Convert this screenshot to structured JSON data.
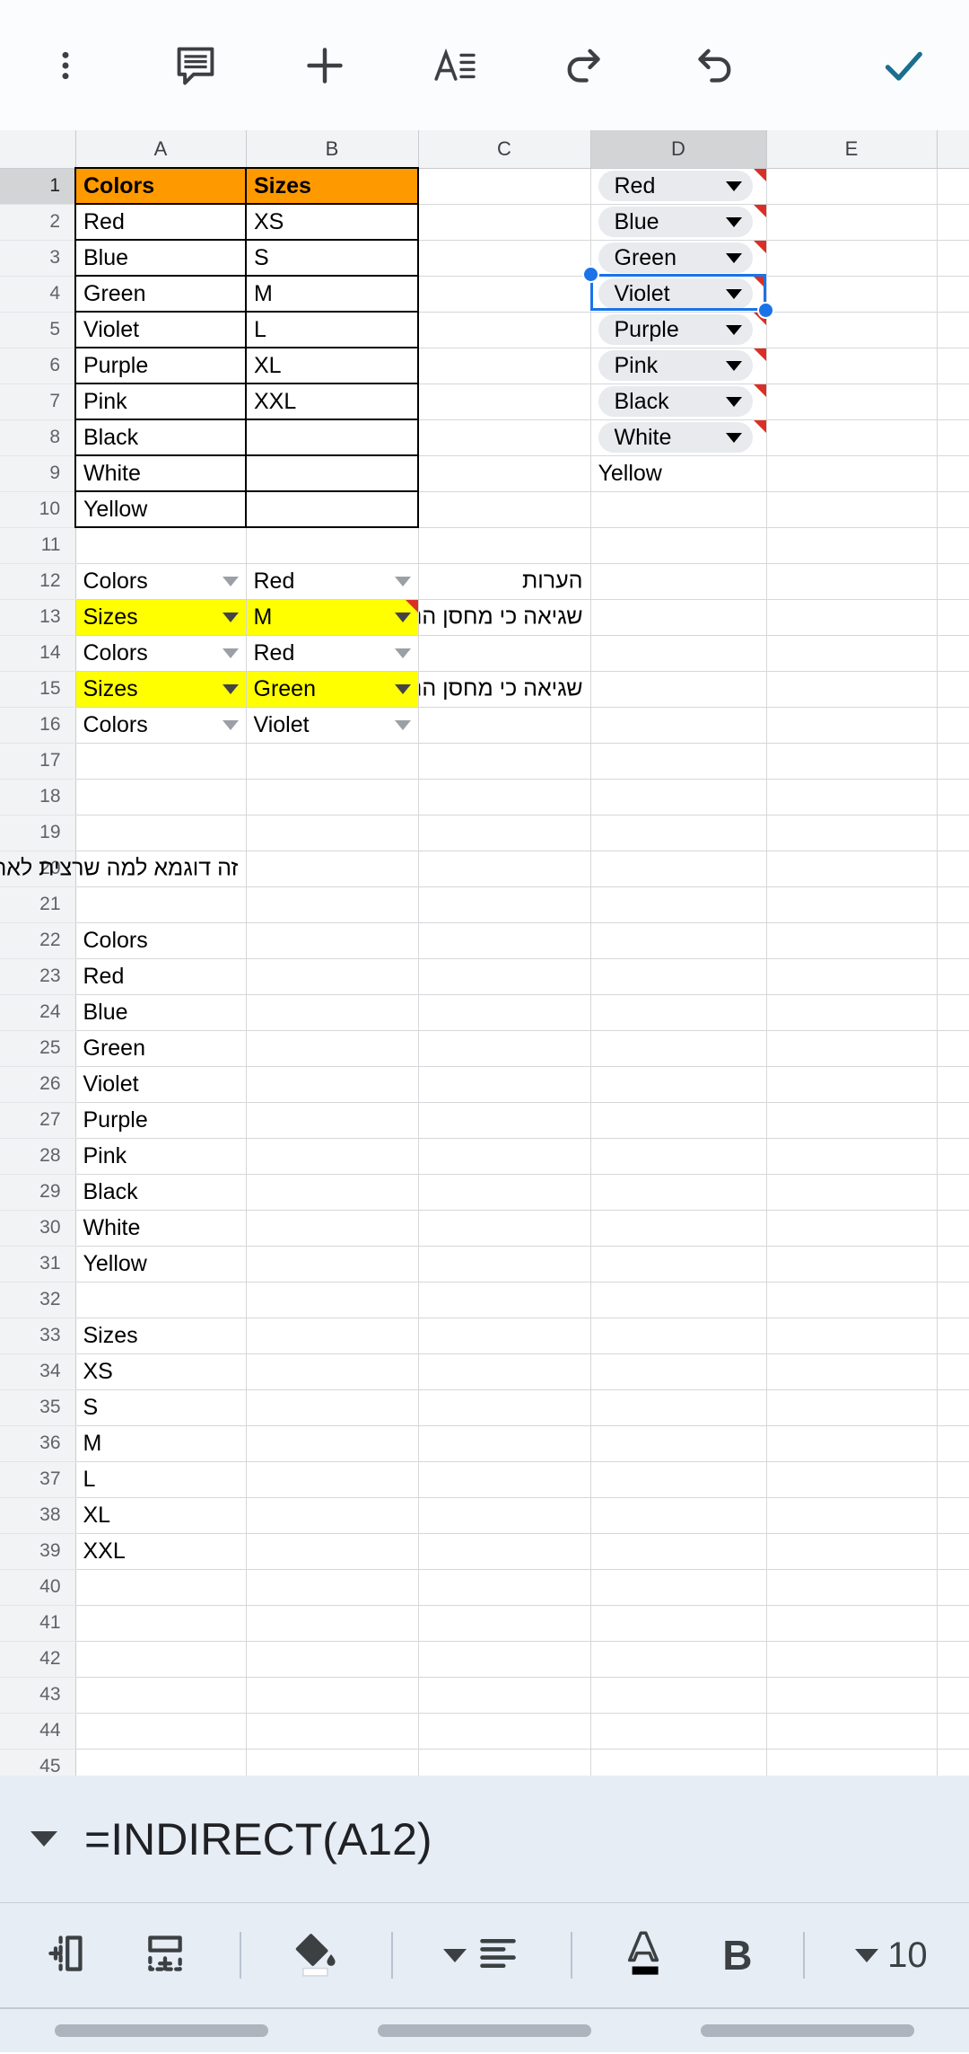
{
  "top_toolbar": {
    "buttons": [
      {
        "name": "more-options-button",
        "icon": "kebab-menu-icon"
      },
      {
        "name": "comment-button",
        "icon": "comment-icon"
      },
      {
        "name": "insert-button",
        "icon": "plus-icon"
      },
      {
        "name": "format-text-button",
        "icon": "format-text-icon"
      },
      {
        "name": "redo-button",
        "icon": "redo-icon"
      },
      {
        "name": "undo-button",
        "icon": "undo-icon"
      },
      {
        "name": "confirm-button",
        "icon": "checkmark-icon"
      }
    ],
    "accent_color": "#1a6f8f"
  },
  "grid": {
    "columns": [
      "A",
      "B",
      "C",
      "D",
      "E"
    ],
    "selected_column": "D",
    "selected_row": 1,
    "selected_cell": "D1",
    "first_row": 1,
    "last_row": 45,
    "colors": {
      "header_fill": "#ff9900",
      "highlight_fill": "#ffff00",
      "chip_fill": "#e8eaed",
      "selection": "#1a73e8",
      "note_flag": "#d93025"
    },
    "rows": [
      {
        "n": 1,
        "a": "Colors",
        "b": "Sizes",
        "c": "",
        "d": "Red",
        "e": ""
      },
      {
        "n": 2,
        "a": "Red",
        "b": "XS",
        "c": "",
        "d": "Blue",
        "e": ""
      },
      {
        "n": 3,
        "a": "Blue",
        "b": "S",
        "c": "",
        "d": "Green",
        "e": ""
      },
      {
        "n": 4,
        "a": "Green",
        "b": "M",
        "c": "",
        "d": "Violet",
        "e": ""
      },
      {
        "n": 5,
        "a": "Violet",
        "b": "L",
        "c": "",
        "d": "Purple",
        "e": ""
      },
      {
        "n": 6,
        "a": "Purple",
        "b": "XL",
        "c": "",
        "d": "Pink",
        "e": ""
      },
      {
        "n": 7,
        "a": "Pink",
        "b": "XXL",
        "c": "",
        "d": "Black",
        "e": ""
      },
      {
        "n": 8,
        "a": "Black",
        "b": "",
        "c": "",
        "d": "White",
        "e": ""
      },
      {
        "n": 9,
        "a": "White",
        "b": "",
        "c": "",
        "d": "Yellow",
        "e": ""
      },
      {
        "n": 10,
        "a": "Yellow",
        "b": "",
        "c": "",
        "d": "",
        "e": ""
      },
      {
        "n": 11,
        "a": "",
        "b": "",
        "c": "",
        "d": "",
        "e": ""
      },
      {
        "n": 12,
        "a": "Colors",
        "b": "Red",
        "c": "הערות",
        "d": "",
        "e": ""
      },
      {
        "n": 13,
        "a": "Sizes",
        "b": "M",
        "c": "שגיאה כי מחסן הנה",
        "d": "",
        "e": ""
      },
      {
        "n": 14,
        "a": "Colors",
        "b": "Red",
        "c": "",
        "d": "",
        "e": ""
      },
      {
        "n": 15,
        "a": "Sizes",
        "b": "Green",
        "c": "שגיאה כי מחסן הנה",
        "d": "",
        "e": ""
      },
      {
        "n": 16,
        "a": "Colors",
        "b": "Violet",
        "c": "",
        "d": "",
        "e": ""
      },
      {
        "n": 17,
        "a": "",
        "b": "",
        "c": "",
        "d": "",
        "e": ""
      },
      {
        "n": 18,
        "a": "",
        "b": "",
        "c": "",
        "d": "",
        "e": ""
      },
      {
        "n": 19,
        "a": "",
        "b": "",
        "c": "",
        "d": "",
        "e": ""
      },
      {
        "n": 20,
        "a": "זה דוגמא למה שרצית לאחד שתי עמודות לעמודה אחת כמט",
        "b": "",
        "c": "",
        "d": "",
        "e": ""
      },
      {
        "n": 21,
        "a": "",
        "b": "",
        "c": "",
        "d": "",
        "e": ""
      },
      {
        "n": 22,
        "a": "Colors",
        "b": "",
        "c": "",
        "d": "",
        "e": ""
      },
      {
        "n": 23,
        "a": "Red",
        "b": "",
        "c": "",
        "d": "",
        "e": ""
      },
      {
        "n": 24,
        "a": "Blue",
        "b": "",
        "c": "",
        "d": "",
        "e": ""
      },
      {
        "n": 25,
        "a": "Green",
        "b": "",
        "c": "",
        "d": "",
        "e": ""
      },
      {
        "n": 26,
        "a": "Violet",
        "b": "",
        "c": "",
        "d": "",
        "e": ""
      },
      {
        "n": 27,
        "a": "Purple",
        "b": "",
        "c": "",
        "d": "",
        "e": ""
      },
      {
        "n": 28,
        "a": "Pink",
        "b": "",
        "c": "",
        "d": "",
        "e": ""
      },
      {
        "n": 29,
        "a": "Black",
        "b": "",
        "c": "",
        "d": "",
        "e": ""
      },
      {
        "n": 30,
        "a": "White",
        "b": "",
        "c": "",
        "d": "",
        "e": ""
      },
      {
        "n": 31,
        "a": "Yellow",
        "b": "",
        "c": "",
        "d": "",
        "e": ""
      },
      {
        "n": 32,
        "a": "",
        "b": "",
        "c": "",
        "d": "",
        "e": ""
      },
      {
        "n": 33,
        "a": "Sizes",
        "b": "",
        "c": "",
        "d": "",
        "e": ""
      },
      {
        "n": 34,
        "a": "XS",
        "b": "",
        "c": "",
        "d": "",
        "e": ""
      },
      {
        "n": 35,
        "a": "S",
        "b": "",
        "c": "",
        "d": "",
        "e": ""
      },
      {
        "n": 36,
        "a": "M",
        "b": "",
        "c": "",
        "d": "",
        "e": ""
      },
      {
        "n": 37,
        "a": "L",
        "b": "",
        "c": "",
        "d": "",
        "e": ""
      },
      {
        "n": 38,
        "a": "XL",
        "b": "",
        "c": "",
        "d": "",
        "e": ""
      },
      {
        "n": 39,
        "a": "XXL",
        "b": "",
        "c": "",
        "d": "",
        "e": ""
      },
      {
        "n": 40,
        "a": "",
        "b": "",
        "c": "",
        "d": "",
        "e": ""
      },
      {
        "n": 41,
        "a": "",
        "b": "",
        "c": "",
        "d": "",
        "e": ""
      },
      {
        "n": 42,
        "a": "",
        "b": "",
        "c": "",
        "d": "",
        "e": ""
      },
      {
        "n": 43,
        "a": "",
        "b": "",
        "c": "",
        "d": "",
        "e": ""
      },
      {
        "n": 44,
        "a": "",
        "b": "",
        "c": "",
        "d": "",
        "e": ""
      },
      {
        "n": 45,
        "a": "",
        "b": "",
        "c": "",
        "d": "",
        "e": ""
      }
    ]
  },
  "formula_bar": {
    "value": "=INDIRECT(A12)",
    "expander_icon": "chevron-down-icon"
  },
  "bottom_toolbar": {
    "items": [
      {
        "name": "insert-column-button",
        "icon": "insert-column-icon"
      },
      {
        "name": "insert-row-button",
        "icon": "insert-row-icon"
      },
      {
        "name": "fill-color-button",
        "icon": "paint-bucket-icon",
        "swatch": "#ffffff"
      },
      {
        "name": "text-align-button",
        "icon": "align-left-icon"
      },
      {
        "name": "text-color-button",
        "icon": "text-color-icon",
        "swatch": "#000000"
      },
      {
        "name": "bold-button",
        "icon": "bold-icon",
        "label": "B"
      },
      {
        "name": "font-size-button",
        "icon": "chevron-down-icon",
        "label": "10"
      }
    ]
  }
}
